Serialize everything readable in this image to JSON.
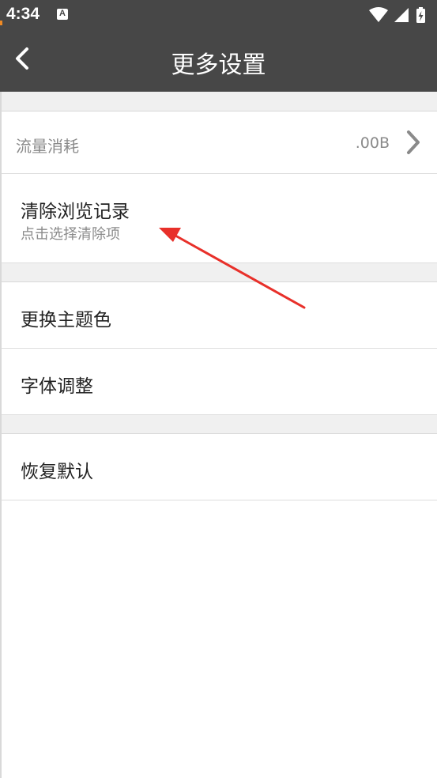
{
  "status_bar": {
    "time": "4:34",
    "notification_icon": "text-a-icon",
    "icons": [
      "wifi-icon",
      "signal-icon",
      "battery-charging-icon"
    ]
  },
  "toolbar": {
    "title": "更多设置",
    "back_icon": "chevron-left-icon"
  },
  "settings": {
    "traffic": {
      "label": "流量消耗",
      "value": ".00B"
    },
    "clear_history": {
      "label": "清除浏览记录",
      "subtitle": "点击选择清除项"
    },
    "theme": {
      "label": "更换主题色"
    },
    "font": {
      "label": "字体调整"
    },
    "reset": {
      "label": "恢复默认"
    }
  },
  "annotation": {
    "arrow_color": "#e8302a"
  }
}
